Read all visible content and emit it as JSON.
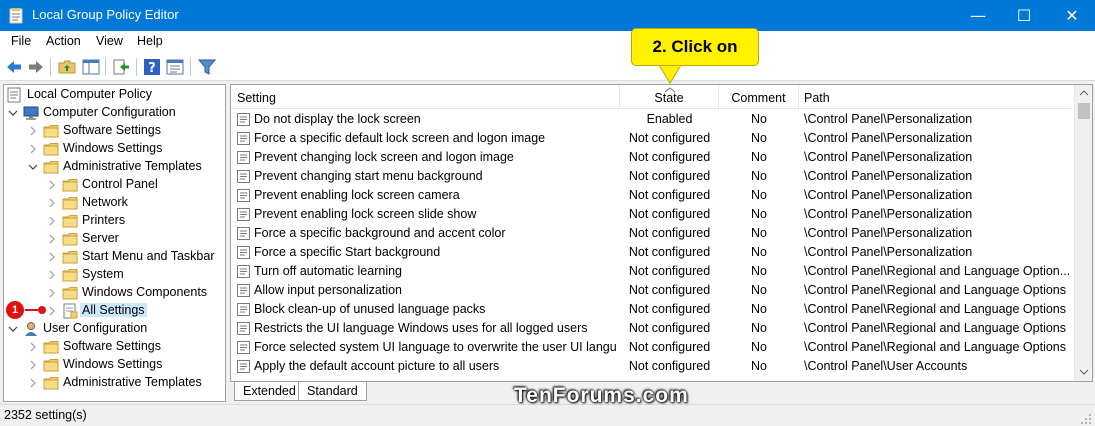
{
  "window": {
    "title": "Local Group Policy Editor",
    "minimize_glyph": "—",
    "maximize_glyph": "☐",
    "close_glyph": "✕"
  },
  "menu": [
    "File",
    "Action",
    "View",
    "Help"
  ],
  "toolbar_icons": [
    "back-arrow-icon",
    "forward-arrow-icon",
    "up-folder-icon",
    "show-hide-tree-icon",
    "export-list-icon",
    "help-icon",
    "properties-icon",
    "filter-icon"
  ],
  "tree": {
    "root": "Local Computer Policy",
    "items": [
      {
        "label": "Computer Configuration",
        "level": 1,
        "expanded": true,
        "icon": "computer-icon"
      },
      {
        "label": "Software Settings",
        "level": 2,
        "expanded": false,
        "icon": "folder-icon"
      },
      {
        "label": "Windows Settings",
        "level": 2,
        "expanded": false,
        "icon": "folder-icon"
      },
      {
        "label": "Administrative Templates",
        "level": 2,
        "expanded": true,
        "icon": "folder-icon"
      },
      {
        "label": "Control Panel",
        "level": 3,
        "expanded": false,
        "icon": "folder-icon"
      },
      {
        "label": "Network",
        "level": 3,
        "expanded": false,
        "icon": "folder-icon"
      },
      {
        "label": "Printers",
        "level": 3,
        "expanded": false,
        "icon": "folder-icon"
      },
      {
        "label": "Server",
        "level": 3,
        "expanded": false,
        "icon": "folder-icon"
      },
      {
        "label": "Start Menu and Taskbar",
        "level": 3,
        "expanded": false,
        "icon": "folder-icon"
      },
      {
        "label": "System",
        "level": 3,
        "expanded": false,
        "icon": "folder-icon"
      },
      {
        "label": "Windows Components",
        "level": 3,
        "expanded": false,
        "icon": "folder-icon"
      },
      {
        "label": "All Settings",
        "level": 3,
        "expanded": false,
        "icon": "all-settings-icon",
        "selected": true
      },
      {
        "label": "User Configuration",
        "level": 1,
        "expanded": true,
        "icon": "user-icon"
      },
      {
        "label": "Software Settings",
        "level": 2,
        "expanded": false,
        "icon": "folder-icon"
      },
      {
        "label": "Windows Settings",
        "level": 2,
        "expanded": false,
        "icon": "folder-icon"
      },
      {
        "label": "Administrative Templates",
        "level": 2,
        "expanded": false,
        "icon": "folder-icon"
      }
    ]
  },
  "list": {
    "columns": [
      "Setting",
      "State",
      "Comment",
      "Path"
    ],
    "rows": [
      [
        "Do not display the lock screen",
        "Enabled",
        "No",
        "\\Control Panel\\Personalization"
      ],
      [
        "Force a specific default lock screen and logon image",
        "Not configured",
        "No",
        "\\Control Panel\\Personalization"
      ],
      [
        "Prevent changing lock screen and logon image",
        "Not configured",
        "No",
        "\\Control Panel\\Personalization"
      ],
      [
        "Prevent changing start menu background",
        "Not configured",
        "No",
        "\\Control Panel\\Personalization"
      ],
      [
        "Prevent enabling lock screen camera",
        "Not configured",
        "No",
        "\\Control Panel\\Personalization"
      ],
      [
        "Prevent enabling lock screen slide show",
        "Not configured",
        "No",
        "\\Control Panel\\Personalization"
      ],
      [
        "Force a specific background and accent color",
        "Not configured",
        "No",
        "\\Control Panel\\Personalization"
      ],
      [
        "Force a specific Start background",
        "Not configured",
        "No",
        "\\Control Panel\\Personalization"
      ],
      [
        "Turn off automatic learning",
        "Not configured",
        "No",
        "\\Control Panel\\Regional and Language Option..."
      ],
      [
        "Allow input personalization",
        "Not configured",
        "No",
        "\\Control Panel\\Regional and Language Options"
      ],
      [
        "Block clean-up of unused language packs",
        "Not configured",
        "No",
        "\\Control Panel\\Regional and Language Options"
      ],
      [
        "Restricts the UI language Windows uses for all logged users",
        "Not configured",
        "No",
        "\\Control Panel\\Regional and Language Options"
      ],
      [
        "Force selected system UI language to overwrite the user UI language",
        "Not configured",
        "No",
        "\\Control Panel\\Regional and Language Options"
      ],
      [
        "Apply the default account picture to all users",
        "Not configured",
        "No",
        "\\Control Panel\\User Accounts"
      ]
    ]
  },
  "tabs": [
    "Extended",
    "Standard"
  ],
  "status": "2352 setting(s)",
  "annotations": {
    "badge": "1",
    "callout": "2. Click on"
  },
  "watermark": "TenForums.com",
  "colors": {
    "titlebar": "#0078d7",
    "callout": "#fef200",
    "badge": "#e01010",
    "selection": "#cce8ff"
  }
}
